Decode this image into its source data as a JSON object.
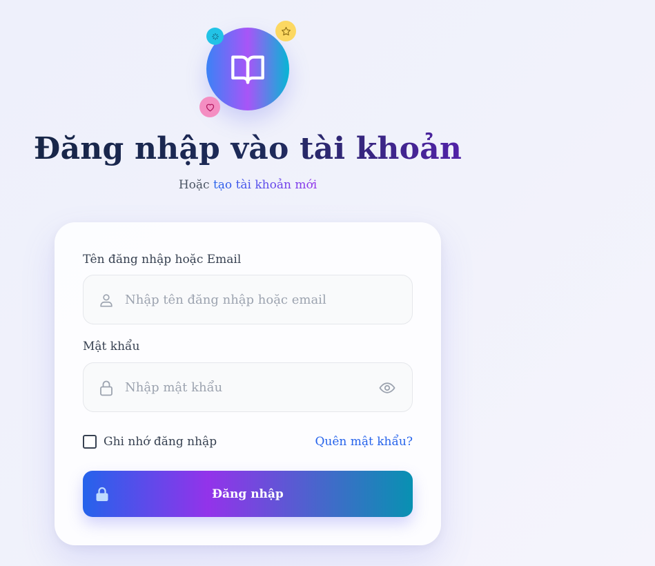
{
  "header": {
    "icons": {
      "main": "open-book-icon",
      "badge_cyan": "sparkle-icon",
      "badge_yellow": "star-icon",
      "badge_pink": "heart-icon"
    },
    "title": "Đăng nhập vào tài khoản",
    "subtitle_prefix": "Hoặc",
    "subtitle_link": "tạo tài khoản mới"
  },
  "form": {
    "username": {
      "label": "Tên đăng nhập hoặc Email",
      "placeholder": "Nhập tên đăng nhập hoặc email",
      "value": "",
      "icon": "user-icon"
    },
    "password": {
      "label": "Mật khẩu",
      "placeholder": "Nhập mật khẩu",
      "value": "",
      "icon": "lock-icon",
      "toggle_icon": "eye-icon"
    },
    "remember_label": "Ghi nhớ đăng nhập",
    "remember_checked": false,
    "forgot_label": "Quên mật khẩu?",
    "submit_label": "Đăng nhập",
    "submit_icon": "lock-icon"
  },
  "colors": {
    "accent_blue": "#2563eb",
    "accent_purple": "#9333ea",
    "accent_teal": "#0891b2",
    "badge_cyan": "#22c3e6",
    "badge_yellow": "#fcd862",
    "badge_pink": "#f48ec2"
  }
}
